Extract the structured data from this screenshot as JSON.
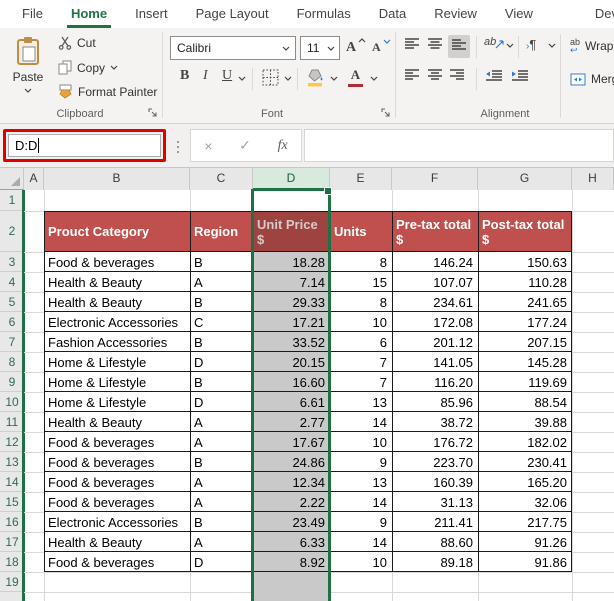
{
  "tabs": {
    "file": "File",
    "home": "Home",
    "insert": "Insert",
    "page_layout": "Page Layout",
    "formulas": "Formulas",
    "data": "Data",
    "review": "Review",
    "view": "View",
    "developer": "Developer",
    "active": "Home"
  },
  "ribbon": {
    "clipboard": {
      "label": "Clipboard",
      "paste": "Paste",
      "cut": "Cut",
      "copy": "Copy",
      "format_painter": "Format Painter"
    },
    "font": {
      "label": "Font",
      "family": "Calibri",
      "size": "11",
      "bold": "B",
      "italic": "I",
      "underline": "U",
      "letter_a": "A"
    },
    "alignment": {
      "label": "Alignment",
      "orientation_text": "ab",
      "pilcrow": "¶",
      "wrap_icon_text": "ab",
      "wrap": "Wrap",
      "merge": "Merg"
    }
  },
  "formula_bar": {
    "name_box_value": "D:D",
    "cancel": "×",
    "enter": "✓",
    "fx": "fx",
    "formula_value": ""
  },
  "grid": {
    "column_headers": [
      "A",
      "B",
      "C",
      "D",
      "E",
      "F",
      "G",
      "H"
    ],
    "selected_column": "D",
    "selected_range": "D:D",
    "row_numbers": [
      1,
      2,
      3,
      4,
      5,
      6,
      7,
      8,
      9,
      10,
      11,
      12,
      13,
      14,
      15,
      16,
      17,
      18,
      19
    ],
    "table": {
      "headers": [
        {
          "text": "Prouct Category",
          "sub": ""
        },
        {
          "text": "Region",
          "sub": ""
        },
        {
          "text": "Unit Price",
          "sub": "$"
        },
        {
          "text": "Units",
          "sub": ""
        },
        {
          "text": "Pre-tax total",
          "sub": "$"
        },
        {
          "text": "Post-tax total",
          "sub": "$"
        }
      ],
      "align": [
        "left",
        "left",
        "right",
        "right",
        "right",
        "right"
      ],
      "rows": [
        [
          "Food & beverages",
          "B",
          "18.28",
          "8",
          "146.24",
          "150.63"
        ],
        [
          "Health & Beauty",
          "A",
          "7.14",
          "15",
          "107.07",
          "110.28"
        ],
        [
          "Health & Beauty",
          "B",
          "29.33",
          "8",
          "234.61",
          "241.65"
        ],
        [
          "Electronic Accessories",
          "C",
          "17.21",
          "10",
          "172.08",
          "177.24"
        ],
        [
          "Fashion Accessories",
          "B",
          "33.52",
          "6",
          "201.12",
          "207.15"
        ],
        [
          "Home & Lifestyle",
          "D",
          "20.15",
          "7",
          "141.05",
          "145.28"
        ],
        [
          "Home & Lifestyle",
          "B",
          "16.60",
          "7",
          "116.20",
          "119.69"
        ],
        [
          "Home & Lifestyle",
          "D",
          "6.61",
          "13",
          "85.96",
          "88.54"
        ],
        [
          "Health & Beauty",
          "A",
          "2.77",
          "14",
          "38.72",
          "39.88"
        ],
        [
          "Food & beverages",
          "A",
          "17.67",
          "10",
          "176.72",
          "182.02"
        ],
        [
          "Food & beverages",
          "B",
          "24.86",
          "9",
          "223.70",
          "230.41"
        ],
        [
          "Food & beverages",
          "A",
          "12.34",
          "13",
          "160.39",
          "165.20"
        ],
        [
          "Food & beverages",
          "A",
          "2.22",
          "14",
          "31.13",
          "32.06"
        ],
        [
          "Electronic Accessories",
          "B",
          "23.49",
          "9",
          "211.41",
          "217.75"
        ],
        [
          "Health & Beauty",
          "A",
          "6.33",
          "14",
          "88.60",
          "91.26"
        ],
        [
          "Food & beverages",
          "D",
          "8.92",
          "10",
          "89.18",
          "91.86"
        ]
      ]
    }
  },
  "colors": {
    "accent_green": "#1E7145",
    "tab_green": "#217346",
    "header_red": "#C0504D",
    "header_red_selected": "#9E4340",
    "selection_gray": "#C9C9C9",
    "annotation_red": "#E00000",
    "selected_col_header": "#D8E9DE"
  }
}
